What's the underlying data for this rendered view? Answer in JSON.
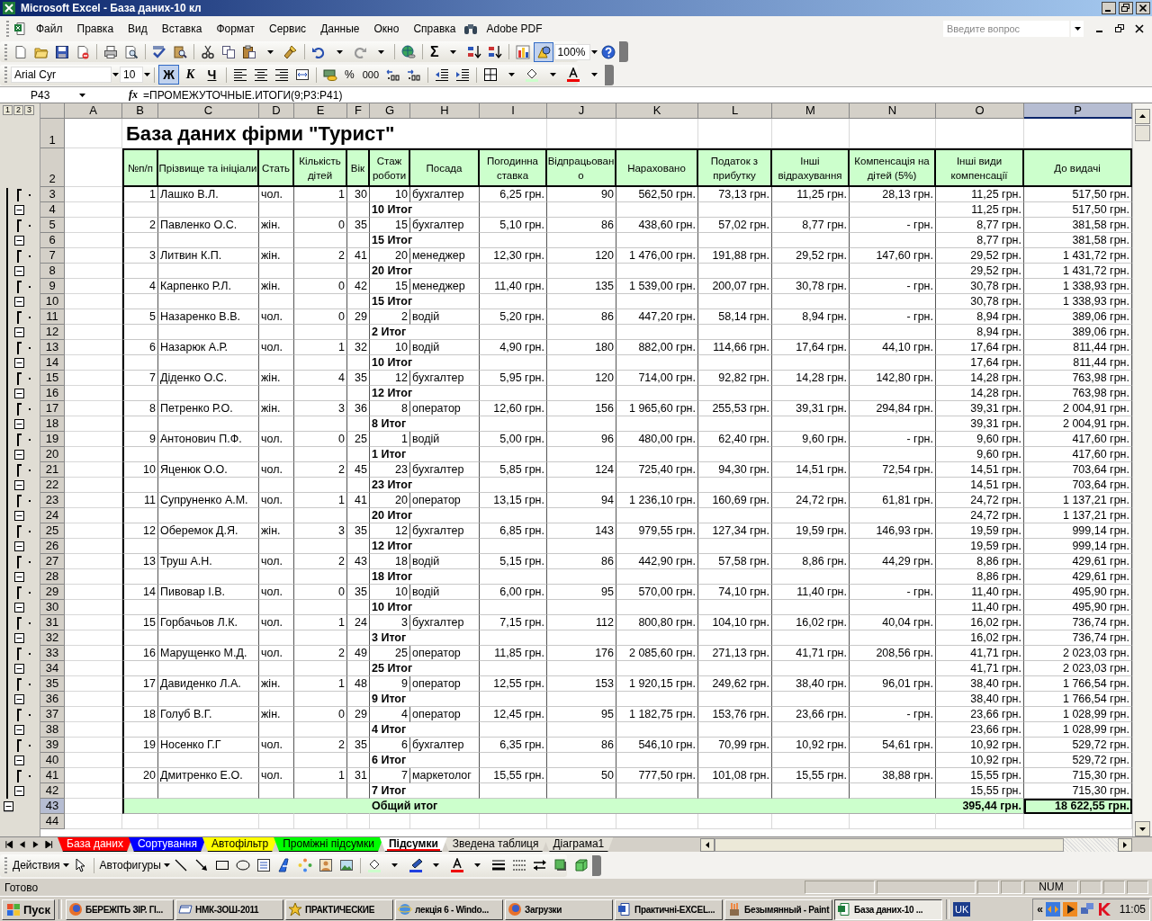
{
  "window": {
    "title": "Microsoft Excel - База даних-10 кл"
  },
  "menu": [
    "Файл",
    "Правка",
    "Вид",
    "Вставка",
    "Формат",
    "Сервис",
    "Данные",
    "Окно",
    "Справка",
    "Adobe PDF"
  ],
  "question_box": {
    "placeholder": "Введите вопрос"
  },
  "standard_toolbar": {
    "autosum": "Σ",
    "zoom": "100%"
  },
  "format_toolbar": {
    "font": "Arial Cyr",
    "size": "10",
    "style_buttons": [
      {
        "label": "Ж",
        "selected": true
      },
      {
        "label": "К",
        "selected": false
      },
      {
        "label": "Ч",
        "selected": false
      }
    ],
    "percent": "%",
    "thousands": "000"
  },
  "formula_bar": {
    "cell": "P43",
    "fx": "fx",
    "formula": "=ПРОМЕЖУТОЧНЫЕ.ИТОГИ(9;P3:P41)"
  },
  "outline_levels": [
    "1",
    "2",
    "3"
  ],
  "sheet": {
    "columns": [
      {
        "label": "A",
        "selected": false
      },
      {
        "label": "B",
        "selected": false
      },
      {
        "label": "C",
        "selected": false
      },
      {
        "label": "D",
        "selected": false
      },
      {
        "label": "E",
        "selected": false
      },
      {
        "label": "F",
        "selected": false
      },
      {
        "label": "G",
        "selected": false
      },
      {
        "label": "H",
        "selected": false
      },
      {
        "label": "I",
        "selected": false
      },
      {
        "label": "J",
        "selected": false
      },
      {
        "label": "K",
        "selected": false
      },
      {
        "label": "L",
        "selected": false
      },
      {
        "label": "M",
        "selected": false
      },
      {
        "label": "N",
        "selected": false
      },
      {
        "label": "O",
        "selected": false
      },
      {
        "label": "P",
        "selected": true
      }
    ],
    "title_row": {
      "row": "1",
      "text": "База даних фірми \"Турист\""
    },
    "header_row": {
      "row": "2",
      "headers": [
        "№п/п",
        "Прізвище та ініціали",
        "Стать",
        "Кількість дітей",
        "Вік",
        "Стаж роботи",
        "Посада",
        "Погодинна ставка",
        "Відпрацьовано",
        "Нараховано",
        "Податок з прибутку",
        "Інші відрахування",
        "Компенсація на дітей (5%)",
        "Інші види компенсації",
        "До видачі"
      ]
    },
    "records": [
      {
        "row": "3",
        "cells": [
          "1",
          "Лашко В.Л.",
          "чол.",
          "1",
          "30",
          "10",
          "бухгалтер",
          "6,25 грн.",
          "90",
          "562,50 грн.",
          "73,13 грн.",
          "11,25 грн.",
          "28,13 грн.",
          "11,25 грн.",
          "517,50 грн."
        ],
        "subtotal": {
          "row": "4",
          "label": "10 Итог",
          "other": "11,25 грн.",
          "payout": "517,50 грн."
        }
      },
      {
        "row": "5",
        "cells": [
          "2",
          "Павленко О.С.",
          "жін.",
          "0",
          "35",
          "15",
          "бухгалтер",
          "5,10 грн.",
          "86",
          "438,60 грн.",
          "57,02 грн.",
          "8,77 грн.",
          "-    грн.",
          "8,77 грн.",
          "381,58 грн."
        ],
        "subtotal": {
          "row": "6",
          "label": "15 Итог",
          "other": "8,77 грн.",
          "payout": "381,58 грн."
        }
      },
      {
        "row": "7",
        "cells": [
          "3",
          "Литвин К.П.",
          "жін.",
          "2",
          "41",
          "20",
          "менеджер",
          "12,30 грн.",
          "120",
          "1 476,00 грн.",
          "191,88 грн.",
          "29,52 грн.",
          "147,60 грн.",
          "29,52 грн.",
          "1 431,72 грн."
        ],
        "subtotal": {
          "row": "8",
          "label": "20 Итог",
          "other": "29,52 грн.",
          "payout": "1 431,72 грн."
        }
      },
      {
        "row": "9",
        "cells": [
          "4",
          "Карпенко Р.Л.",
          "жін.",
          "0",
          "42",
          "15",
          "менеджер",
          "11,40 грн.",
          "135",
          "1 539,00 грн.",
          "200,07 грн.",
          "30,78 грн.",
          "-    грн.",
          "30,78 грн.",
          "1 338,93 грн."
        ],
        "subtotal": {
          "row": "10",
          "label": "15 Итог",
          "other": "30,78 грн.",
          "payout": "1 338,93 грн."
        }
      },
      {
        "row": "11",
        "cells": [
          "5",
          "Назаренко В.В.",
          "чол.",
          "0",
          "29",
          "2",
          "водій",
          "5,20 грн.",
          "86",
          "447,20 грн.",
          "58,14 грн.",
          "8,94 грн.",
          "-    грн.",
          "8,94 грн.",
          "389,06 грн."
        ],
        "subtotal": {
          "row": "12",
          "label": "2 Итог",
          "other": "8,94 грн.",
          "payout": "389,06 грн."
        }
      },
      {
        "row": "13",
        "cells": [
          "6",
          "Назарюк А.Р.",
          "чол.",
          "1",
          "32",
          "10",
          "водій",
          "4,90 грн.",
          "180",
          "882,00 грн.",
          "114,66 грн.",
          "17,64 грн.",
          "44,10 грн.",
          "17,64 грн.",
          "811,44 грн."
        ],
        "subtotal": {
          "row": "14",
          "label": "10 Итог",
          "other": "17,64 грн.",
          "payout": "811,44 грн."
        }
      },
      {
        "row": "15",
        "cells": [
          "7",
          "Діденко О.С.",
          "жін.",
          "4",
          "35",
          "12",
          "бухгалтер",
          "5,95 грн.",
          "120",
          "714,00 грн.",
          "92,82 грн.",
          "14,28 грн.",
          "142,80 грн.",
          "14,28 грн.",
          "763,98 грн."
        ],
        "subtotal": {
          "row": "16",
          "label": "12 Итог",
          "other": "14,28 грн.",
          "payout": "763,98 грн."
        }
      },
      {
        "row": "17",
        "cells": [
          "8",
          "Петренко Р.О.",
          "жін.",
          "3",
          "36",
          "8",
          "оператор",
          "12,60 грн.",
          "156",
          "1 965,60 грн.",
          "255,53 грн.",
          "39,31 грн.",
          "294,84 грн.",
          "39,31 грн.",
          "2 004,91 грн."
        ],
        "subtotal": {
          "row": "18",
          "label": "8 Итог",
          "other": "39,31 грн.",
          "payout": "2 004,91 грн."
        }
      },
      {
        "row": "19",
        "cells": [
          "9",
          "Антонович П.Ф.",
          "чол.",
          "0",
          "25",
          "1",
          "водій",
          "5,00 грн.",
          "96",
          "480,00 грн.",
          "62,40 грн.",
          "9,60 грн.",
          "-    грн.",
          "9,60 грн.",
          "417,60 грн."
        ],
        "subtotal": {
          "row": "20",
          "label": "1 Итог",
          "other": "9,60 грн.",
          "payout": "417,60 грн."
        }
      },
      {
        "row": "21",
        "cells": [
          "10",
          "Яценюк О.О.",
          "чол.",
          "2",
          "45",
          "23",
          "бухгалтер",
          "5,85 грн.",
          "124",
          "725,40 грн.",
          "94,30 грн.",
          "14,51 грн.",
          "72,54 грн.",
          "14,51 грн.",
          "703,64 грн."
        ],
        "subtotal": {
          "row": "22",
          "label": "23 Итог",
          "other": "14,51 грн.",
          "payout": "703,64 грн."
        }
      },
      {
        "row": "23",
        "cells": [
          "11",
          "Супруненко А.М.",
          "чол.",
          "1",
          "41",
          "20",
          "оператор",
          "13,15 грн.",
          "94",
          "1 236,10 грн.",
          "160,69 грн.",
          "24,72 грн.",
          "61,81 грн.",
          "24,72 грн.",
          "1 137,21 грн."
        ],
        "subtotal": {
          "row": "24",
          "label": "20 Итог",
          "other": "24,72 грн.",
          "payout": "1 137,21 грн."
        }
      },
      {
        "row": "25",
        "cells": [
          "12",
          "Оберемок Д.Я.",
          "жін.",
          "3",
          "35",
          "12",
          "бухгалтер",
          "6,85 грн.",
          "143",
          "979,55 грн.",
          "127,34 грн.",
          "19,59 грн.",
          "146,93 грн.",
          "19,59 грн.",
          "999,14 грн."
        ],
        "subtotal": {
          "row": "26",
          "label": "12 Итог",
          "other": "19,59 грн.",
          "payout": "999,14 грн."
        }
      },
      {
        "row": "27",
        "cells": [
          "13",
          "Труш А.Н.",
          "чол.",
          "2",
          "43",
          "18",
          "водій",
          "5,15 грн.",
          "86",
          "442,90 грн.",
          "57,58 грн.",
          "8,86 грн.",
          "44,29 грн.",
          "8,86 грн.",
          "429,61 грн."
        ],
        "subtotal": {
          "row": "28",
          "label": "18 Итог",
          "other": "8,86 грн.",
          "payout": "429,61 грн."
        }
      },
      {
        "row": "29",
        "cells": [
          "14",
          "Пивовар І.В.",
          "чол.",
          "0",
          "35",
          "10",
          "водій",
          "6,00 грн.",
          "95",
          "570,00 грн.",
          "74,10 грн.",
          "11,40 грн.",
          "-    грн.",
          "11,40 грн.",
          "495,90 грн."
        ],
        "subtotal": {
          "row": "30",
          "label": "10 Итог",
          "other": "11,40 грн.",
          "payout": "495,90 грн."
        }
      },
      {
        "row": "31",
        "cells": [
          "15",
          "Горбачьов Л.К.",
          "чол.",
          "1",
          "24",
          "3",
          "бухгалтер",
          "7,15 грн.",
          "112",
          "800,80 грн.",
          "104,10 грн.",
          "16,02 грн.",
          "40,04 грн.",
          "16,02 грн.",
          "736,74 грн."
        ],
        "subtotal": {
          "row": "32",
          "label": "3 Итог",
          "other": "16,02 грн.",
          "payout": "736,74 грн."
        }
      },
      {
        "row": "33",
        "cells": [
          "16",
          "Марущенко М.Д.",
          "чол.",
          "2",
          "49",
          "25",
          "оператор",
          "11,85 грн.",
          "176",
          "2 085,60 грн.",
          "271,13 грн.",
          "41,71 грн.",
          "208,56 грн.",
          "41,71 грн.",
          "2 023,03 грн."
        ],
        "subtotal": {
          "row": "34",
          "label": "25 Итог",
          "other": "41,71 грн.",
          "payout": "2 023,03 грн."
        }
      },
      {
        "row": "35",
        "cells": [
          "17",
          "Давиденко Л.А.",
          "жін.",
          "1",
          "48",
          "9",
          "оператор",
          "12,55 грн.",
          "153",
          "1 920,15 грн.",
          "249,62 грн.",
          "38,40 грн.",
          "96,01 грн.",
          "38,40 грн.",
          "1 766,54 грн."
        ],
        "subtotal": {
          "row": "36",
          "label": "9 Итог",
          "other": "38,40 грн.",
          "payout": "1 766,54 грн."
        }
      },
      {
        "row": "37",
        "cells": [
          "18",
          "Голуб В.Г.",
          "жін.",
          "0",
          "29",
          "4",
          "оператор",
          "12,45 грн.",
          "95",
          "1 182,75 грн.",
          "153,76 грн.",
          "23,66 грн.",
          "-    грн.",
          "23,66 грн.",
          "1 028,99 грн."
        ],
        "subtotal": {
          "row": "38",
          "label": "4 Итог",
          "other": "23,66 грн.",
          "payout": "1 028,99 грн."
        }
      },
      {
        "row": "39",
        "cells": [
          "19",
          "Носенко Г.Г",
          "чол.",
          "2",
          "35",
          "6",
          "бухгалтер",
          "6,35 грн.",
          "86",
          "546,10 грн.",
          "70,99 грн.",
          "10,92 грн.",
          "54,61 грн.",
          "10,92 грн.",
          "529,72 грн."
        ],
        "subtotal": {
          "row": "40",
          "label": "6 Итог",
          "other": "10,92 грн.",
          "payout": "529,72 грн."
        }
      },
      {
        "row": "41",
        "cells": [
          "20",
          "Дмитренко Е.О.",
          "чол.",
          "1",
          "31",
          "7",
          "маркетолог",
          "15,55 грн.",
          "50",
          "777,50 грн.",
          "101,08 грн.",
          "15,55 грн.",
          "38,88 грн.",
          "15,55 грн.",
          "715,30 грн."
        ],
        "subtotal": {
          "row": "42",
          "label": "7 Итог",
          "other": "15,55 грн.",
          "payout": "715,30 грн."
        }
      }
    ],
    "total_row": {
      "row": "43",
      "label": "Общий итог",
      "other": "395,44 грн.",
      "payout": "18 622,55 грн.",
      "selected": true
    },
    "empty_rows": [
      "44"
    ]
  },
  "sheet_tabs": [
    {
      "label": "База даних",
      "color": "#ff0000",
      "selected": false
    },
    {
      "label": "Сортування",
      "color": "#0000ff",
      "selected": false
    },
    {
      "label": "Автофільтр",
      "color": "#ffff00",
      "selected": false
    },
    {
      "label": "Проміжні підсумки",
      "color": "#00ff00",
      "selected": false
    },
    {
      "label": "Підсумки",
      "color": "#ff0000",
      "selected": true
    },
    {
      "label": "Зведена таблиця",
      "selected": false
    },
    {
      "label": "Діаграма1",
      "selected": false
    }
  ],
  "drawing_toolbar": {
    "actions": "Действия",
    "autoshapes": "Автофигуры"
  },
  "status_bar": {
    "message": "Готово",
    "num": "NUM"
  },
  "taskbar": {
    "start": "Пуск",
    "items": [
      {
        "label": "БЕРЕЖІТЬ ЗІР. ГІ...",
        "kind": "browser",
        "selected": false
      },
      {
        "label": "НМК-ЗОШ-2011",
        "kind": "folder",
        "selected": false
      },
      {
        "label": "ПРАКТИЧЕСКИЕ",
        "kind": "star",
        "selected": false
      },
      {
        "label": "лекція 6 - Windo...",
        "kind": "ie",
        "selected": false
      },
      {
        "label": "Загрузки",
        "kind": "browser",
        "selected": false
      },
      {
        "label": "Практичні-EXCEL...",
        "kind": "word",
        "selected": false
      },
      {
        "label": "Безымянный - Paint",
        "kind": "paint",
        "selected": false
      },
      {
        "label": "База даних-10 ...",
        "kind": "excel",
        "selected": true
      }
    ],
    "language": "UK",
    "tray_toggle": "«",
    "clock": "11:05"
  }
}
